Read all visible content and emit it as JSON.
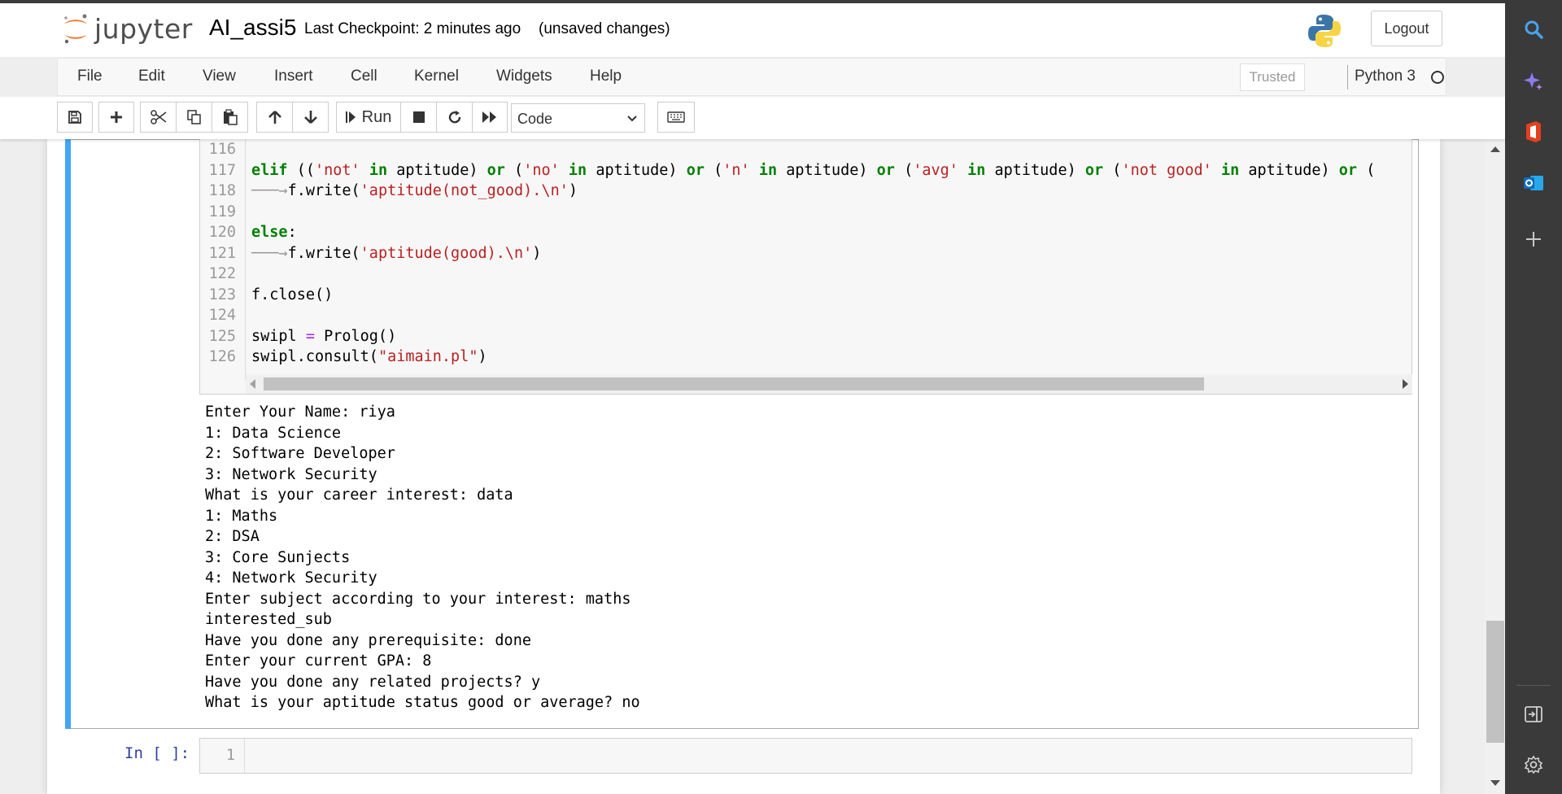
{
  "header": {
    "logo_text": "jupyter",
    "notebook_title": "AI_assi5",
    "checkpoint": "Last Checkpoint: 2 minutes ago",
    "save_status": "(unsaved changes)",
    "logout_label": "Logout"
  },
  "menubar": {
    "items": [
      "File",
      "Edit",
      "View",
      "Insert",
      "Cell",
      "Kernel",
      "Widgets",
      "Help"
    ],
    "trusted_label": "Trusted",
    "kernel_name": "Python 3"
  },
  "toolbar": {
    "run_label": "Run",
    "cell_type": "Code",
    "icons": [
      "save-icon",
      "plus-icon",
      "cut-icon",
      "copy-icon",
      "paste-icon",
      "arrow-up-icon",
      "arrow-down-icon",
      "run-icon",
      "stop-icon",
      "restart-icon",
      "fast-forward-icon",
      "keyboard-icon"
    ]
  },
  "code_cell": {
    "line_numbers": [
      "116",
      "117",
      "118",
      "119",
      "120",
      "121",
      "122",
      "123",
      "124",
      "125",
      "126"
    ],
    "lines": [
      "",
      "elif (('not' in aptitude) or ('no' in aptitude) or ('n' in aptitude) or ('avg' in aptitude) or ('not good' in aptitude) or (",
      "    f.write('aptitude(not_good).\\n')",
      "",
      "else:",
      "    f.write('aptitude(good).\\n')",
      "",
      "f.close()",
      "",
      "swipl = Prolog()",
      "swipl.consult(\"aimain.pl\")"
    ]
  },
  "output": {
    "lines": [
      "Enter Your Name: riya",
      "1: Data Science",
      "2: Software Developer",
      "3: Network Security",
      "What is your career interest: data",
      "1: Maths",
      "2: DSA",
      "3: Core Sunjects",
      "4: Network Security",
      "Enter subject according to your interest: maths",
      "interested_sub",
      "Have you done any prerequisite: done",
      "Enter your current GPA: 8",
      "Have you done any related projects? y",
      "What is your aptitude status good or average? no"
    ]
  },
  "empty_cell": {
    "prompt": "In [ ]:",
    "line_number": "1"
  },
  "colors": {
    "keyword": "#008000",
    "string": "#ba2121",
    "operator": "#aa22ff",
    "selected_cell_bar": "#42a5f5",
    "prompt": "#303f9f"
  }
}
